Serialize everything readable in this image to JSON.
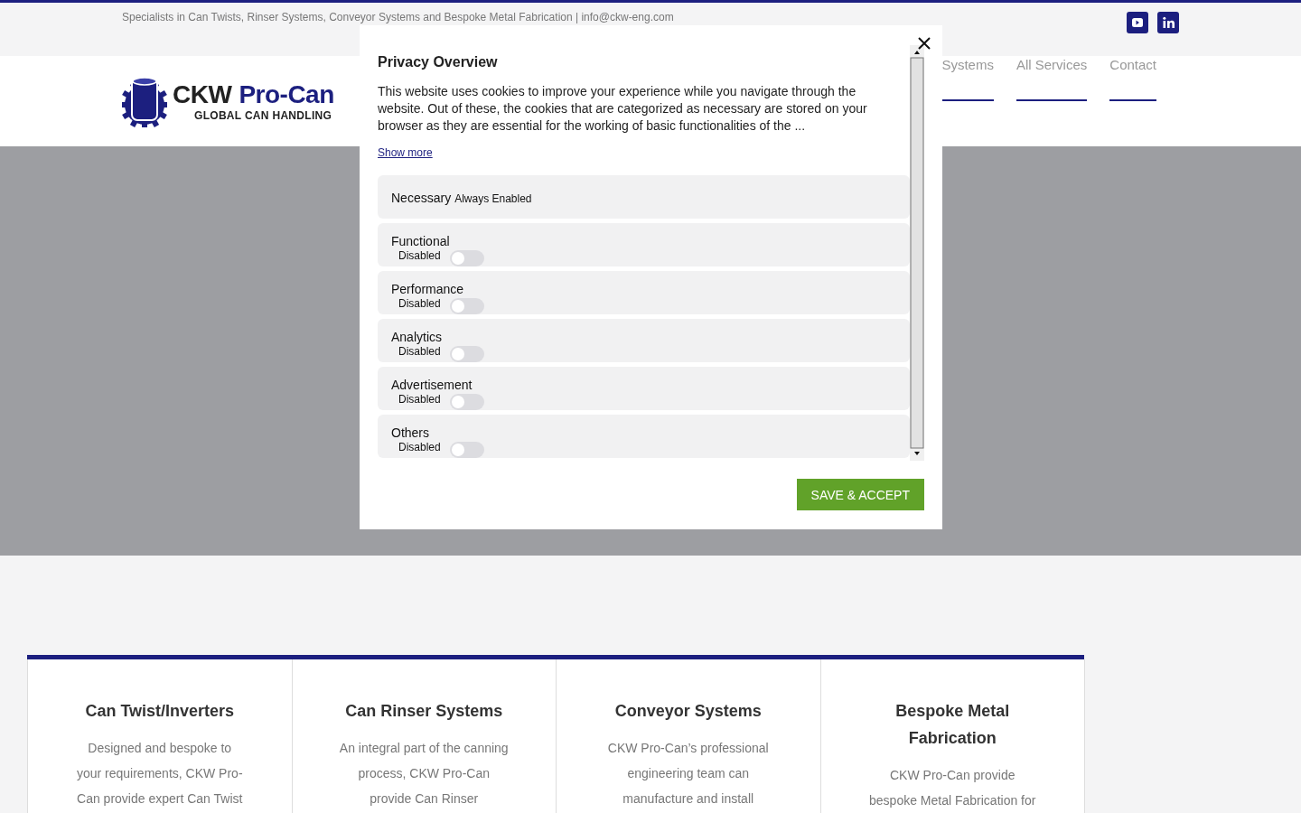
{
  "top_bar": {
    "tagline": "Specialists in Can Twists, Rinser Systems, Conveyor Systems and Bespoke Metal Fabrication  |  info@ckw-eng.com"
  },
  "logo": {
    "name_dark": "CKW",
    "name_blue": "Pro-Can",
    "subtitle": "GLOBAL CAN HANDLING"
  },
  "nav": [
    {
      "label": "Systems"
    },
    {
      "label": "All Services"
    },
    {
      "label": "Contact"
    }
  ],
  "cards": [
    {
      "title": "Can Twist/Inverters",
      "text": "Designed and bespoke to your requirements, CKW Pro-Can provide expert Can Twist"
    },
    {
      "title": "Can Rinser Systems",
      "text": "An integral part of the canning process, CKW Pro-Can provide Can Rinser"
    },
    {
      "title": "Conveyor Systems",
      "text": "CKW Pro-Can’s professional engineering team can manufacture and install"
    },
    {
      "title": "Bespoke Metal Fabrication",
      "text": "CKW Pro-Can provide bespoke Metal Fabrication for"
    }
  ],
  "modal": {
    "title": "Privacy Overview",
    "text": "This website uses cookies to improve your experience while you navigate through the website. Out of these, the cookies that are categorized as necessary are stored on your browser as they are essential for the working of basic functionalities of the ...",
    "show_more": "Show more",
    "categories": [
      {
        "kind": "always",
        "label": "Necessary",
        "status": "Always Enabled"
      },
      {
        "kind": "toggle",
        "label": "Functional",
        "status": "Disabled",
        "on": false
      },
      {
        "kind": "toggle",
        "label": "Performance",
        "status": "Disabled",
        "on": false
      },
      {
        "kind": "toggle",
        "label": "Analytics",
        "status": "Disabled",
        "on": false
      },
      {
        "kind": "toggle",
        "label": "Advertisement",
        "status": "Disabled",
        "on": false
      },
      {
        "kind": "toggle",
        "label": "Others",
        "status": "Disabled",
        "on": false
      }
    ],
    "button": "SAVE & ACCEPT"
  }
}
